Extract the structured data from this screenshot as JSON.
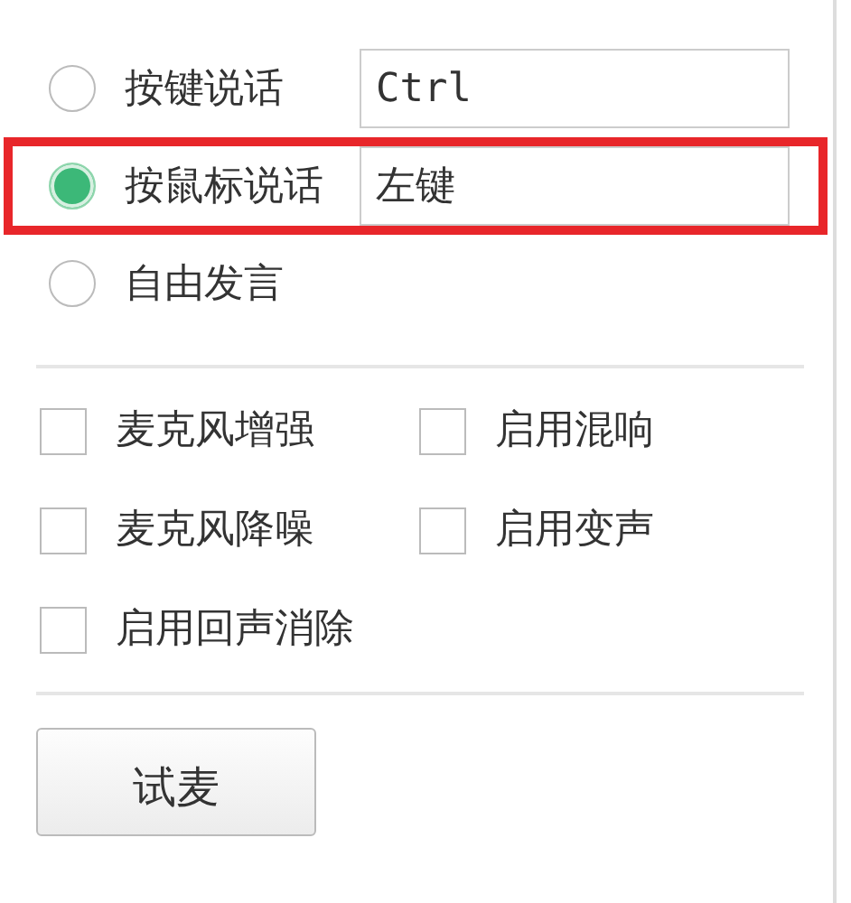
{
  "speak_modes": [
    {
      "label": "按键说话",
      "selected": false,
      "hotkey": "Ctrl",
      "highlighted": false
    },
    {
      "label": "按鼠标说话",
      "selected": true,
      "hotkey": "左键",
      "highlighted": true
    },
    {
      "label": "自由发言",
      "selected": false,
      "highlighted": false
    }
  ],
  "options": [
    {
      "label": "麦克风增强",
      "checked": false
    },
    {
      "label": "启用混响",
      "checked": false
    },
    {
      "label": "麦克风降噪",
      "checked": false
    },
    {
      "label": "启用变声",
      "checked": false
    },
    {
      "label": "启用回声消除",
      "checked": false
    }
  ],
  "buttons": [
    "试麦"
  ]
}
